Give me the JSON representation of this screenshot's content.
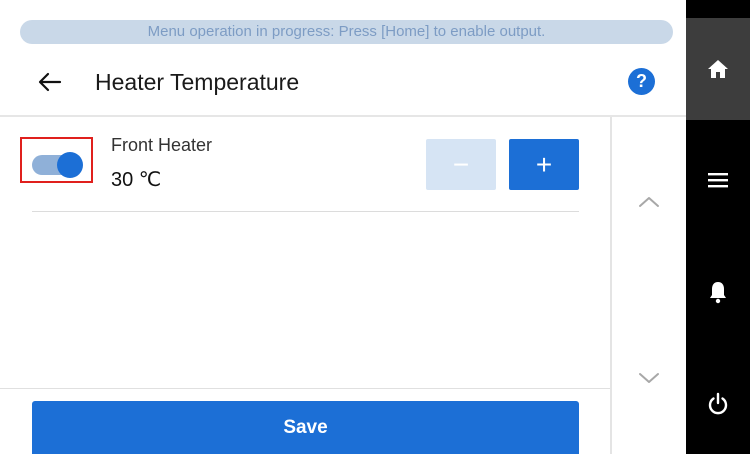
{
  "banner": {
    "text": "Menu operation in progress: Press [Home] to enable output."
  },
  "header": {
    "title": "Heater Temperature",
    "help_label": "?",
    "back_icon": "back-arrow-icon"
  },
  "setting": {
    "label": "Front Heater",
    "value": "30 ℃",
    "enabled": true,
    "decrease_label": "−",
    "increase_label": "+"
  },
  "footer": {
    "save_label": "Save"
  },
  "sidebar": {
    "items": [
      {
        "icon": "home-icon"
      },
      {
        "icon": "menu-icon"
      },
      {
        "icon": "bell-icon"
      },
      {
        "icon": "power-icon"
      }
    ]
  },
  "colors": {
    "accent": "#1c6fd6",
    "accent_disabled": "#d6e4f4",
    "banner_bg": "#c9d8e8",
    "banner_text": "#7d9cc4",
    "highlight_frame": "#e0201d",
    "sidebar_bg": "#000000",
    "sidebar_active": "#3d3d3d"
  }
}
